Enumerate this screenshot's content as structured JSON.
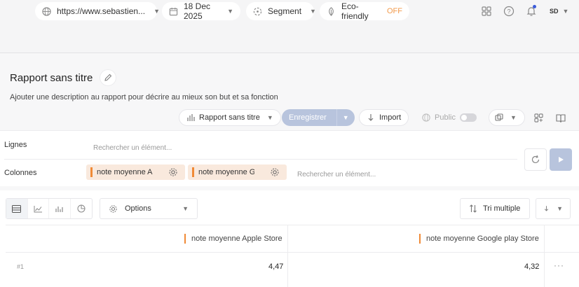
{
  "topbar": {
    "url": "https://www.sebastien...",
    "date": "18 Dec 2025",
    "segment": "Segment",
    "eco_label": "Eco-friendly",
    "eco_state": "OFF",
    "user_initials": "SD"
  },
  "report": {
    "title": "Rapport sans titre",
    "description": "Ajouter une description au rapport pour décrire au mieux son but et sa fonction"
  },
  "toolbar": {
    "report_select": "Rapport sans titre",
    "save_label": "Enregistrer",
    "import_label": "Import",
    "public_label": "Public"
  },
  "builder": {
    "rows_label": "Lignes",
    "columns_label": "Colonnes",
    "search_placeholder": "Rechercher un élément...",
    "chips": [
      "note moyenne Apple Store",
      "note moyenne Google play Store"
    ]
  },
  "table": {
    "options_label": "Options",
    "sort_label": "Tri multiple",
    "headers": [
      "note moyenne Apple Store",
      "note moyenne Google play Store"
    ],
    "rows": [
      {
        "num": "#1",
        "values": [
          "4,47",
          "4,32"
        ]
      }
    ],
    "row_menu": "···"
  },
  "colors": {
    "accent": "#f08a36",
    "primary_disabled": "#b8c4dd",
    "off": "#f2994a"
  }
}
